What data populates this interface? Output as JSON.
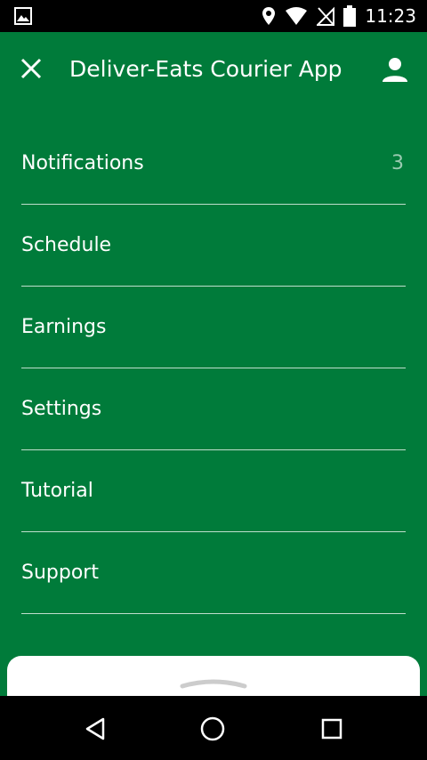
{
  "status_bar": {
    "time": "11:23",
    "icons": [
      "image-icon",
      "location-icon",
      "wifi-icon",
      "no-signal-icon",
      "battery-icon"
    ]
  },
  "header": {
    "title": "Deliver-Eats Courier App",
    "close_icon": "close-icon",
    "profile_icon": "person-icon"
  },
  "menu": {
    "items": [
      {
        "label": "Notifications",
        "count": "3"
      },
      {
        "label": "Schedule",
        "count": ""
      },
      {
        "label": "Earnings",
        "count": ""
      },
      {
        "label": "Settings",
        "count": ""
      },
      {
        "label": "Tutorial",
        "count": ""
      },
      {
        "label": "Support",
        "count": ""
      }
    ]
  },
  "colors": {
    "background": "#007B3A",
    "text": "#FFFFFF",
    "divider": "#CFE6D8",
    "status_bar": "#000000"
  },
  "nav_bar": {
    "icons": [
      "back-icon",
      "home-icon",
      "recents-icon"
    ]
  }
}
